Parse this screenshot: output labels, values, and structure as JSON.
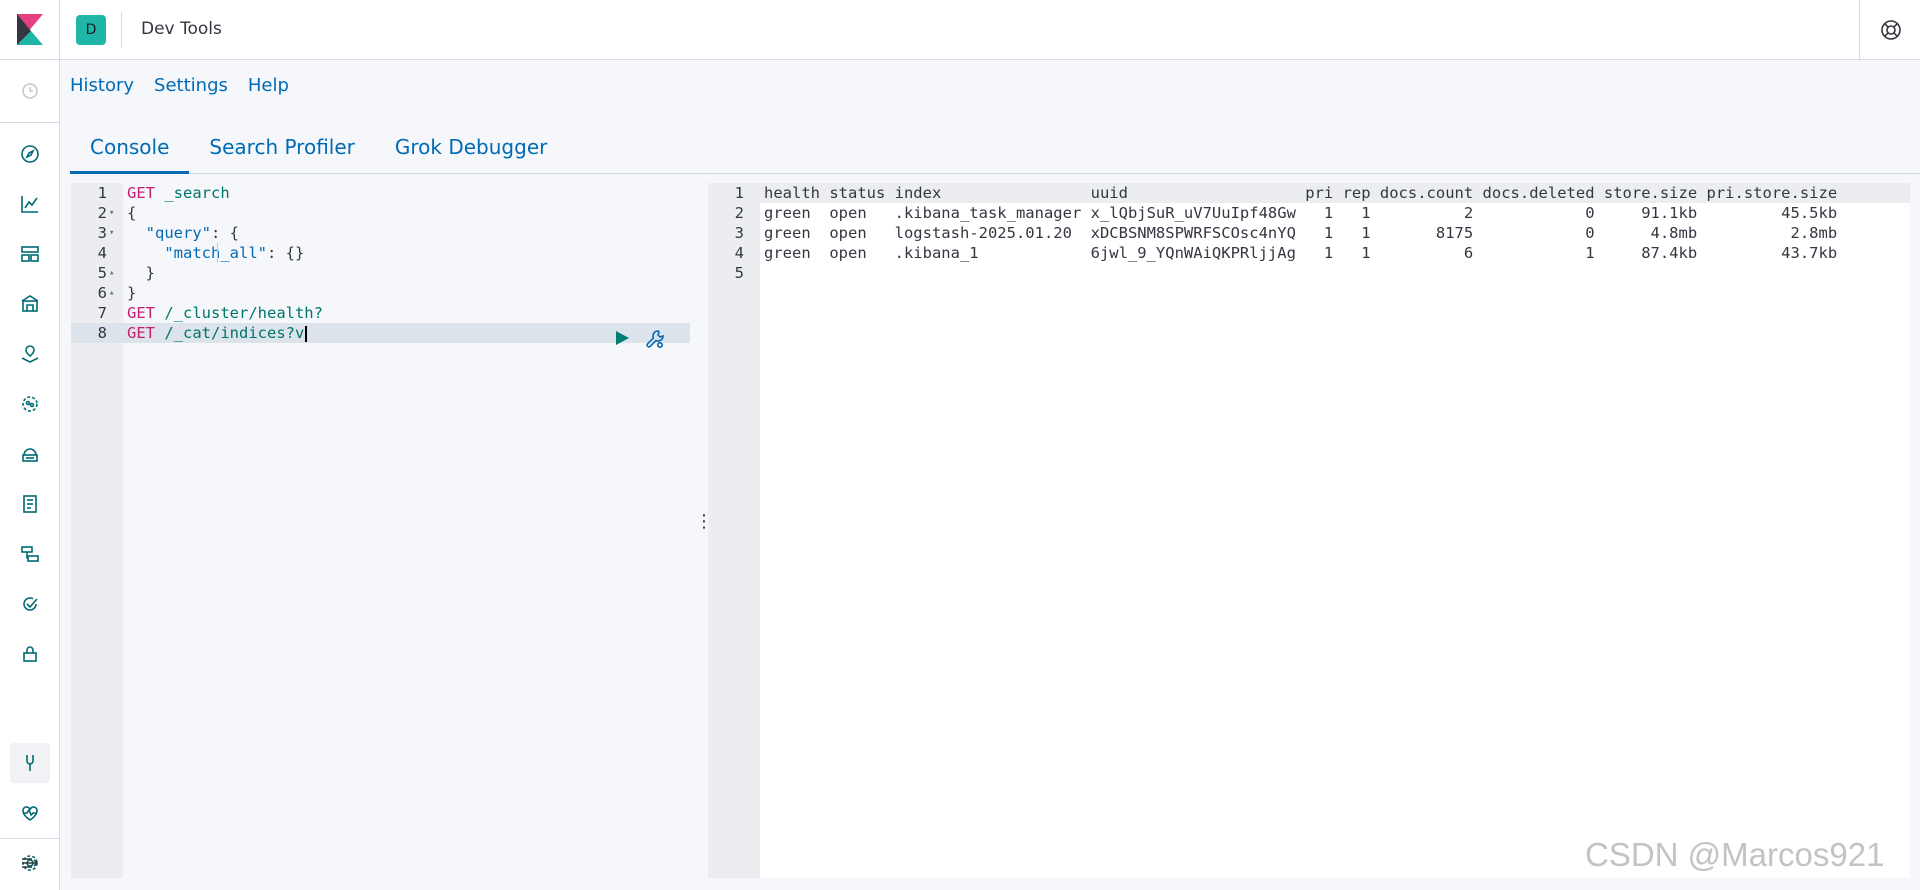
{
  "header": {
    "app_title": "Dev Tools",
    "space_initial": "D",
    "accent_color": "#1fb5a7"
  },
  "leftnav": {
    "icons": [
      "clock-icon",
      "compass-icon",
      "chart-icon",
      "dashboard-icon",
      "canvas-icon",
      "maps-icon",
      "ml-icon",
      "infra-icon",
      "logs-icon",
      "apm-icon",
      "uptime-icon",
      "siem-icon",
      "devtools-icon",
      "monitoring-icon",
      "management-icon",
      "collapse-icon"
    ]
  },
  "topmenu": {
    "history": "History",
    "settings": "Settings",
    "help": "Help"
  },
  "tabs": [
    {
      "label": "Console",
      "active": true
    },
    {
      "label": "Search Profiler",
      "active": false
    },
    {
      "label": "Grok Debugger",
      "active": false
    }
  ],
  "editor": {
    "lines": [
      {
        "n": "1",
        "method": "GET",
        "rest": " _search"
      },
      {
        "n": "2",
        "text": "{"
      },
      {
        "n": "3",
        "key": "\"query\"",
        "rest": ": {"
      },
      {
        "n": "4",
        "key": "\"match_all\"",
        "rest": ": {}"
      },
      {
        "n": "5",
        "text": "  }"
      },
      {
        "n": "6",
        "text": "}"
      },
      {
        "n": "7",
        "method": "GET",
        "rest": " /_cluster/health?"
      },
      {
        "n": "8",
        "method": "GET",
        "rest": " /_cat/indices?v"
      }
    ]
  },
  "output": {
    "lines": [
      {
        "n": "1",
        "text": "health status index                uuid                   pri rep docs.count docs.deleted store.size pri.store.size"
      },
      {
        "n": "2",
        "text": "green  open   .kibana_task_manager x_lQbjSuR_uV7UuIpf48Gw   1   1          2            0     91.1kb         45.5kb"
      },
      {
        "n": "3",
        "text": "green  open   logstash-2025.01.20  xDCBSNM8SPWRFSCOsc4nYQ   1   1       8175            0      4.8mb          2.8mb"
      },
      {
        "n": "4",
        "text": "green  open   .kibana_1            6jwl_9_YQnWAiQKPRljjAg   1   1          6            1     87.4kb         43.7kb"
      },
      {
        "n": "5",
        "text": ""
      }
    ]
  },
  "watermark": "CSDN @Marcos921"
}
